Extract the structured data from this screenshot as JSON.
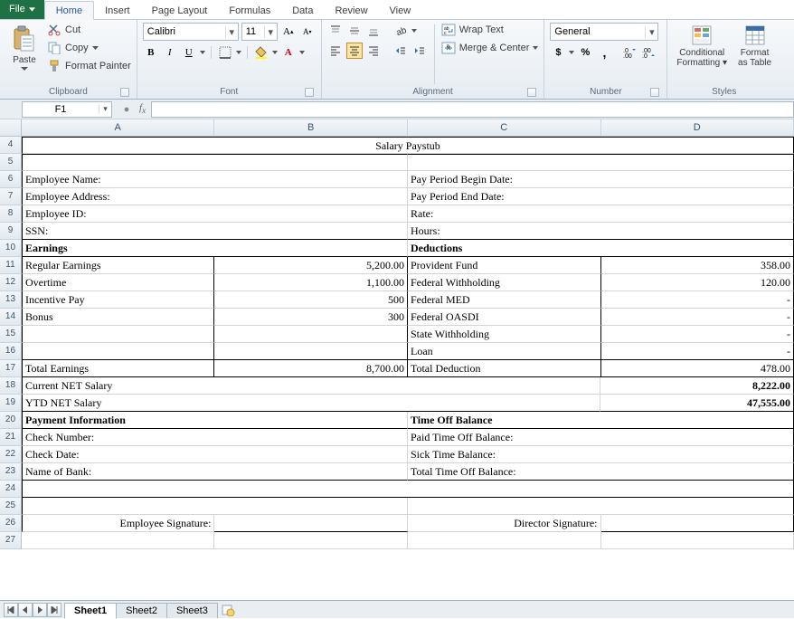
{
  "tabs": {
    "file": "File",
    "home": "Home",
    "insert": "Insert",
    "pagelayout": "Page Layout",
    "formulas": "Formulas",
    "data": "Data",
    "review": "Review",
    "view": "View"
  },
  "clipboard": {
    "paste": "Paste",
    "cut": "Cut",
    "copy": "Copy ",
    "fmtpainter": "Format Painter",
    "label": "Clipboard"
  },
  "font": {
    "name": "Calibri",
    "size": "11",
    "label": "Font"
  },
  "alignment": {
    "wrap": "Wrap Text",
    "merge": "Merge & Center ",
    "label": "Alignment"
  },
  "number": {
    "format": "General",
    "label": "Number"
  },
  "styles": {
    "cond": "Conditional",
    "cond2": "Formatting ",
    "fmt": "Format",
    "fmt2": "as Table",
    "label": "Styles"
  },
  "namebox": "F1",
  "fx": "",
  "cols": [
    "A",
    "B",
    "C",
    "D"
  ],
  "sheet": {
    "r4": {
      "title": "Salary Paystub"
    },
    "r6": {
      "a": "Employee Name:",
      "c": "Pay Period Begin Date:"
    },
    "r7": {
      "a": "Employee Address:",
      "c": "Pay Period End Date:"
    },
    "r8": {
      "a": "Employee ID:",
      "c": "Rate:"
    },
    "r9": {
      "a": "SSN:",
      "c": "Hours:"
    },
    "r10": {
      "a": "Earnings",
      "c": "Deductions"
    },
    "r11": {
      "a": "Regular Earnings",
      "b": "5,200.00",
      "c": "Provident Fund",
      "d": "358.00"
    },
    "r12": {
      "a": "Overtime",
      "b": "1,100.00",
      "c": "Federal Withholding",
      "d": "120.00"
    },
    "r13": {
      "a": "Incentive Pay",
      "b": "500",
      "c": "Federal MED",
      "d": "-"
    },
    "r14": {
      "a": "Bonus",
      "b": "300",
      "c": "Federal OASDI",
      "d": "-"
    },
    "r15": {
      "c": "State Withholding",
      "d": "-"
    },
    "r16": {
      "c": "Loan",
      "d": "-"
    },
    "r17": {
      "a": "Total Earnings",
      "b": "8,700.00",
      "c": "Total Deduction",
      "d": "478.00"
    },
    "r18": {
      "a": "Current NET Salary",
      "d": "8,222.00"
    },
    "r19": {
      "a": "YTD NET Salary",
      "d": "47,555.00"
    },
    "r20": {
      "a": "Payment Information",
      "c": "Time Off Balance"
    },
    "r21": {
      "a": "Check  Number:",
      "c": "Paid Time Off Balance:"
    },
    "r22": {
      "a": "Check Date:",
      "c": "Sick Time Balance:"
    },
    "r23": {
      "a": "Name of Bank:",
      "c": "Total Time Off Balance:"
    },
    "r26": {
      "a": "Employee Signature:",
      "c": "Director  Signature:"
    }
  },
  "sheets": {
    "s1": "Sheet1",
    "s2": "Sheet2",
    "s3": "Sheet3"
  }
}
